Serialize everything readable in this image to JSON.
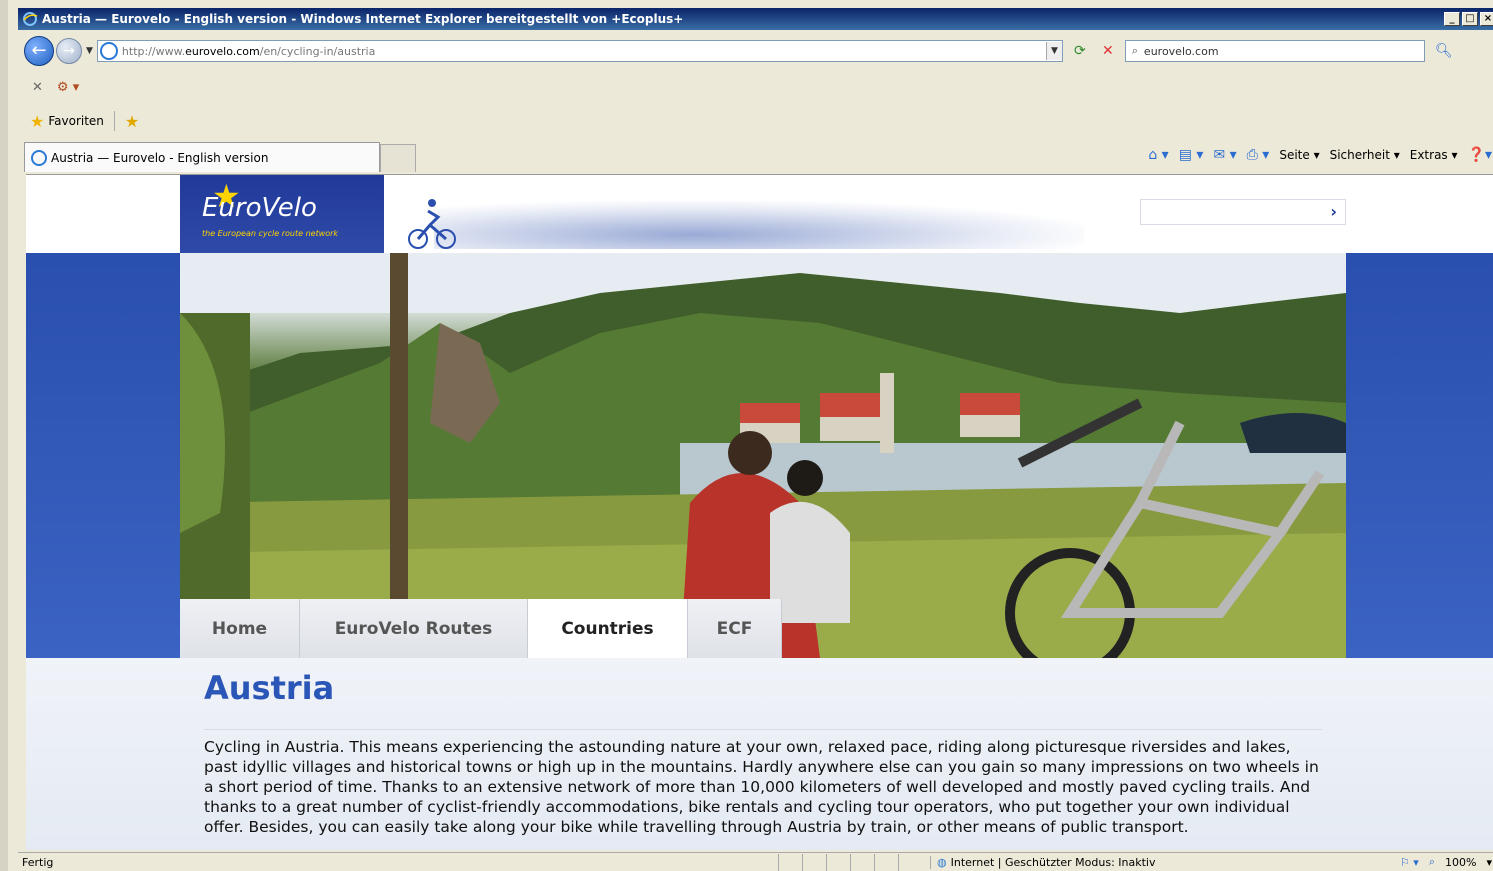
{
  "window": {
    "title": "Austria — Eurovelo - English version - Windows Internet Explorer bereitgestellt von +Ecoplus+",
    "controls": [
      "_",
      "□",
      "×"
    ]
  },
  "address_bar": {
    "url_prefix": "http://www.",
    "url_domain": "eurovelo.com",
    "url_path": "/en/cycling-in/austria",
    "search_value": "eurovelo.com"
  },
  "favorites": {
    "label": "Favoriten"
  },
  "tab": {
    "label": "Austria — Eurovelo - English version"
  },
  "command_bar": {
    "page": "Seite",
    "safety": "Sicherheit",
    "extras": "Extras"
  },
  "site": {
    "logo_text": "EuroVelo",
    "logo_tagline": "the European cycle route network",
    "search_go": "›"
  },
  "nav": [
    {
      "label": "Home",
      "active": false
    },
    {
      "label": "EuroVelo Routes",
      "active": false
    },
    {
      "label": "Countries",
      "active": true
    },
    {
      "label": "ECF",
      "active": false
    }
  ],
  "content": {
    "title": "Austria",
    "body": "Cycling in Austria. This means experiencing the astounding nature at your own, relaxed pace, riding along picturesque riversides and lakes, past idyllic villages and historical towns or high up in the mountains. Hardly anywhere else can you gain so many impressions on two wheels in a short period of time. Thanks to an extensive network of more than 10,000 kilometers of well developed and mostly paved cycling trails. And thanks to a great number of cyclist-friendly accommodations, bike rentals and cycling tour operators, who put together your own individual offer. Besides, you can easily take along your bike while travelling through Austria by train, or other means of public transport."
  },
  "status": {
    "left": "Fertig",
    "zone": "Internet | Geschützter Modus: Inaktiv",
    "zoom": "100%"
  },
  "colors": {
    "brand_blue": "#2a4fae",
    "title_blue": "#2a56b8",
    "logo_star": "#ffd400"
  }
}
